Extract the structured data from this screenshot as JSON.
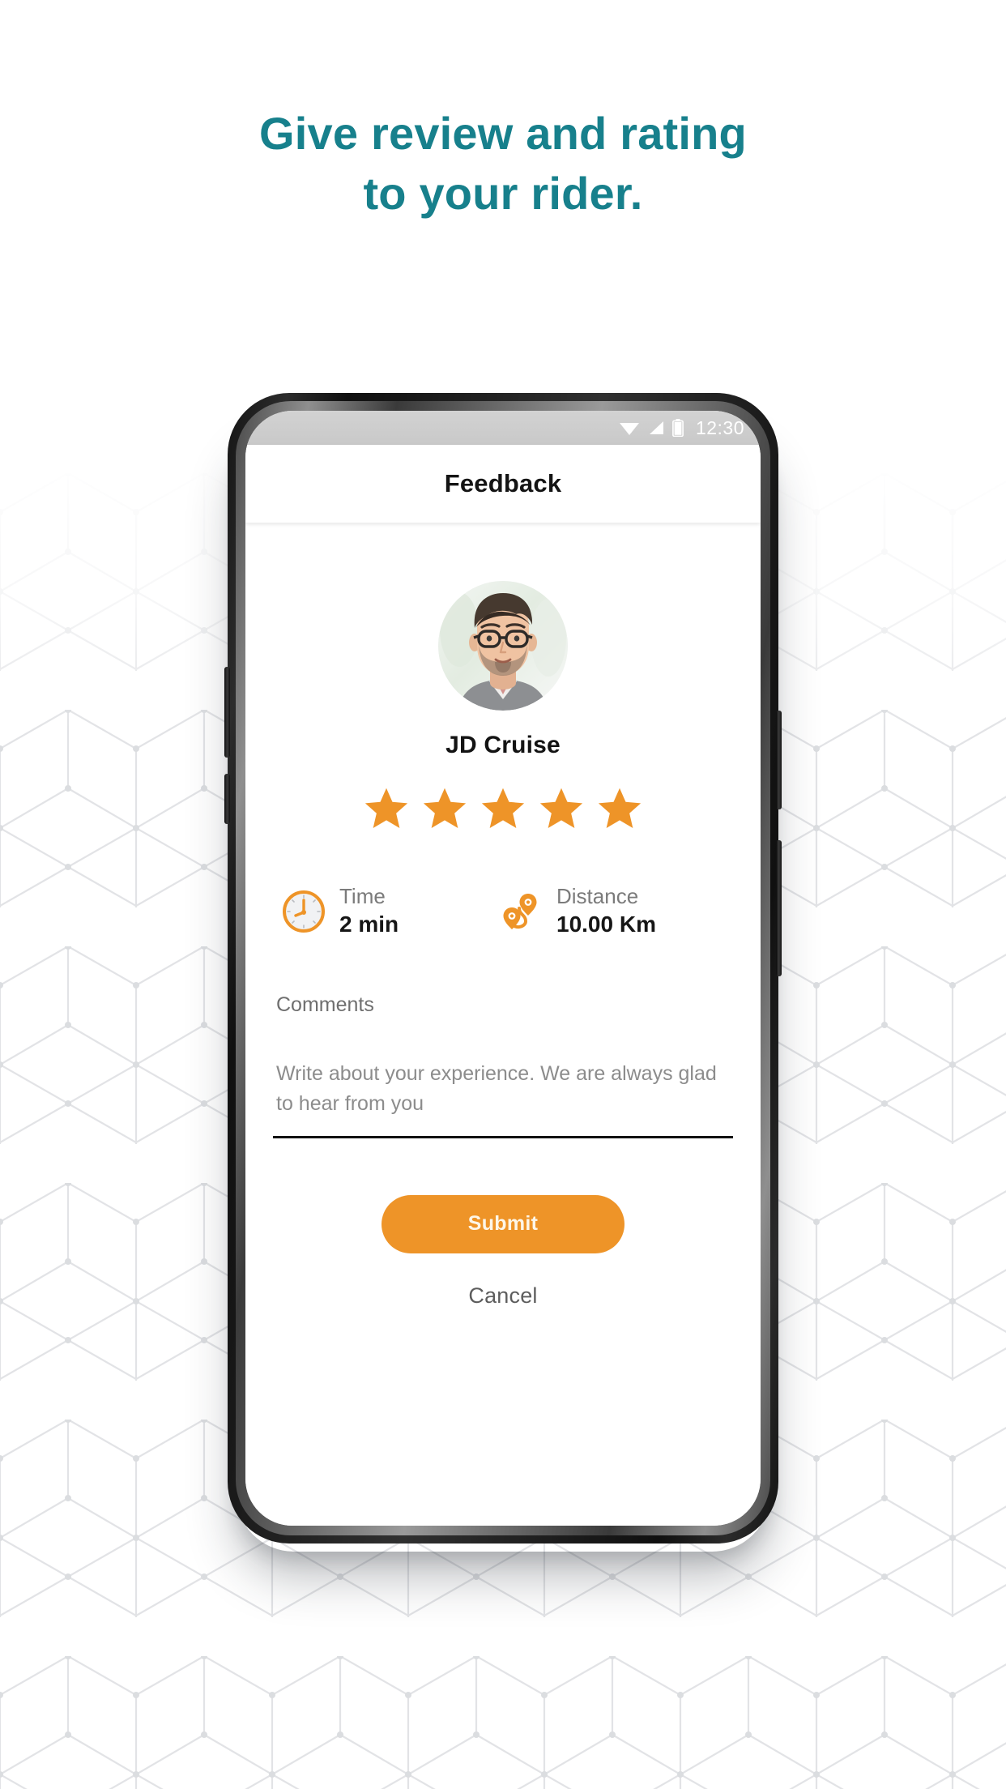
{
  "headline": {
    "line1": "Give review and rating",
    "line2": "to your rider.",
    "color": "#17808c"
  },
  "phone": {
    "status_bar": {
      "time": "12:30",
      "icons": [
        "wifi-icon",
        "signal-icon",
        "battery-icon"
      ],
      "background_color": "#cdcdcd"
    },
    "app_bar": {
      "title": "Feedback"
    },
    "feedback": {
      "avatar_alt": "rider-avatar",
      "rider_name": "JD Cruise",
      "rating": {
        "value": 5,
        "max": 5,
        "star_color": "#ee9428"
      },
      "stats": [
        {
          "icon": "clock-icon",
          "label": "Time",
          "value": "2 min"
        },
        {
          "icon": "route-pin-icon",
          "label": "Distance",
          "value": "10.00  Km"
        }
      ],
      "comments": {
        "label": "Comments",
        "placeholder": "Write about your experience. We are always glad to hear from you",
        "value": ""
      },
      "submit_label": "Submit",
      "cancel_label": "Cancel",
      "accent_color": "#ee9428"
    }
  }
}
